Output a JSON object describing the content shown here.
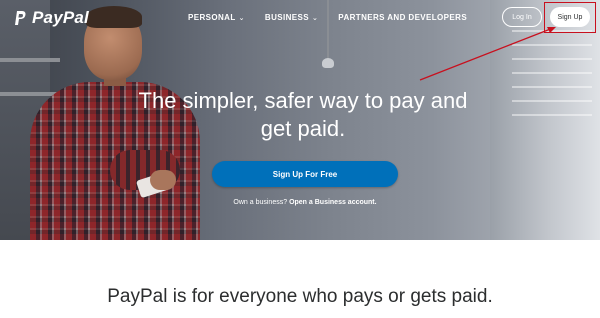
{
  "brand": {
    "name": "PayPal"
  },
  "nav": {
    "links": [
      {
        "label": "PERSONAL",
        "has_dropdown": true
      },
      {
        "label": "BUSINESS",
        "has_dropdown": true
      },
      {
        "label": "PARTNERS AND DEVELOPERS",
        "has_dropdown": false
      }
    ],
    "login_label": "Log In",
    "signup_label": "Sign Up"
  },
  "hero": {
    "headline": "The simpler, safer way to pay and get paid.",
    "cta_label": "Sign Up For Free",
    "business_prompt": "Own a business?",
    "business_link": "Open a Business account."
  },
  "section": {
    "tagline": "PayPal is for everyone who pays or gets paid."
  },
  "annotation": {
    "highlight_color": "#c8101e"
  },
  "colors": {
    "cta": "#0070ba",
    "text_dark": "#2c2e2f"
  }
}
